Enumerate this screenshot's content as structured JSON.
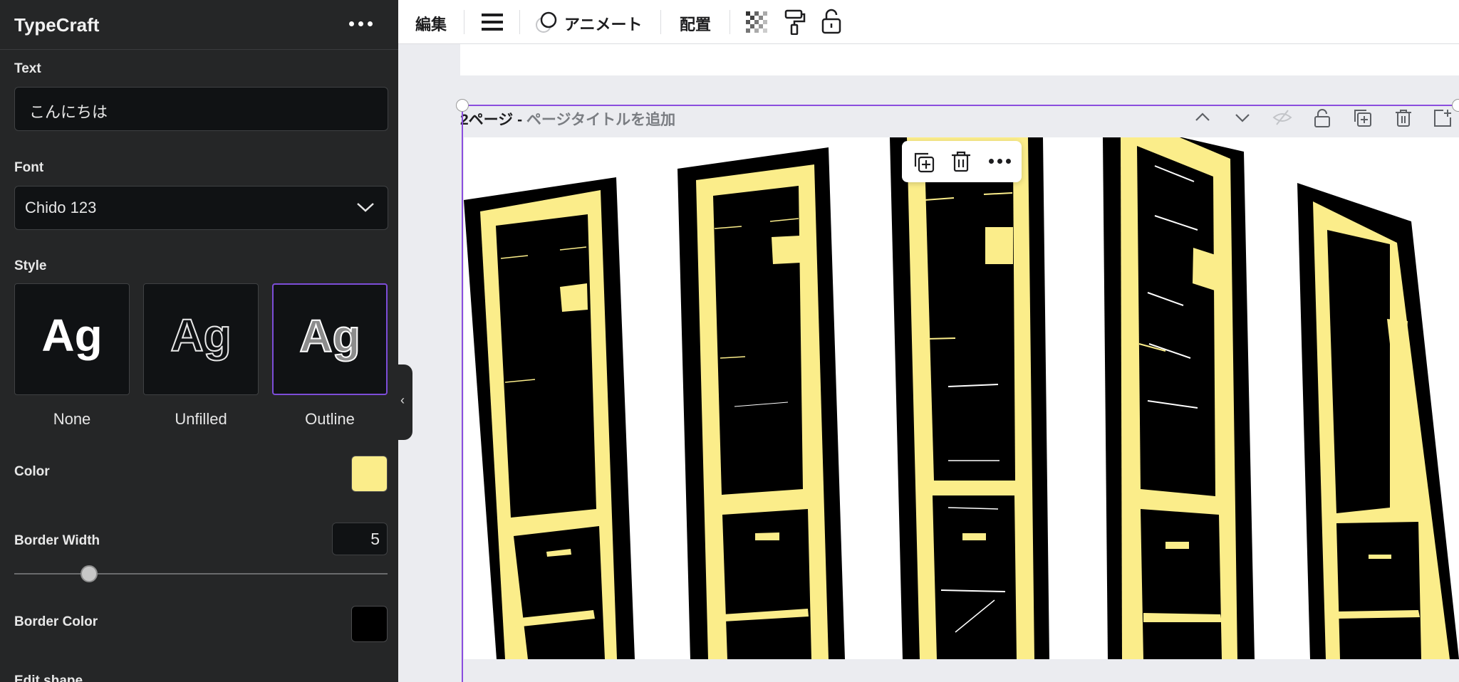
{
  "panel": {
    "app_title": "TypeCraft",
    "text_label": "Text",
    "text_value": "こんにちは",
    "font_label": "Font",
    "font_value": "Chido 123",
    "style_label": "Style",
    "style_sample": "Ag",
    "styles": [
      {
        "label": "None"
      },
      {
        "label": "Unfilled"
      },
      {
        "label": "Outline",
        "selected": true
      }
    ],
    "color_label": "Color",
    "color_value": "#fbed8a",
    "border_width_label": "Border Width",
    "border_width_value": "5",
    "border_width_slider_fraction": 0.2,
    "border_color_label": "Border Color",
    "border_color_value": "#000000",
    "edit_shape_label": "Edit shape"
  },
  "toolbar": {
    "edit": "編集",
    "animate": "アニメート",
    "position": "配置",
    "icons": [
      "menu-icon",
      "animate-icon",
      "transparency-icon",
      "paint-roller-icon",
      "lock-icon"
    ]
  },
  "canvas": {
    "page_number": "2ページ - ",
    "page_title_placeholder": "ページタイトルを追加",
    "page_controls": [
      "chevron-up-icon",
      "chevron-down-icon",
      "hide-icon",
      "lock-icon",
      "duplicate-icon",
      "delete-icon",
      "add-page-icon"
    ],
    "context_menu": [
      "duplicate-icon",
      "delete-icon",
      "more-icon"
    ],
    "accent": "#8a4dde",
    "artwork_fill": "#fbed8a"
  }
}
